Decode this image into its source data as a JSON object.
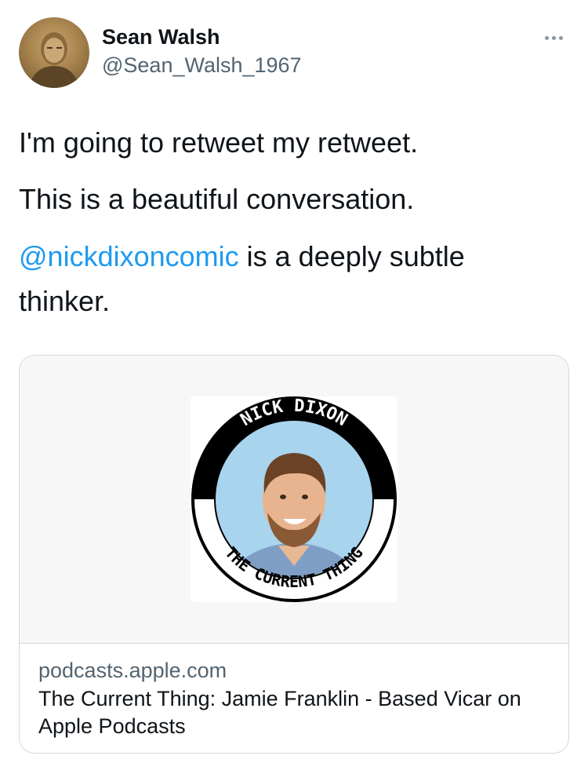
{
  "author": {
    "name": "Sean Walsh",
    "handle": "@Sean_Walsh_1967",
    "avatar_icon": "profile-photo"
  },
  "more_icon": "more-options-icon",
  "tweet": {
    "line1": "I'm going to retweet  my retweet.",
    "line2": "This is a beautiful conversation.",
    "mention": "@nickdixoncomic",
    "line3_rest": "  is  a deeply subtle",
    "line4": "thinker."
  },
  "card": {
    "cover": {
      "top_text": "NICK DIXON",
      "bottom_text": "THE CURRENT THING"
    },
    "domain": "podcasts.apple.com",
    "title": "The Current Thing: Jamie Franklin - Based Vicar on Apple Podcasts"
  },
  "colors": {
    "link": "#1d9bf0",
    "secondary_text": "#536471",
    "card_border": "#cfd9de",
    "podcast_bg": "#a8d4ee"
  }
}
